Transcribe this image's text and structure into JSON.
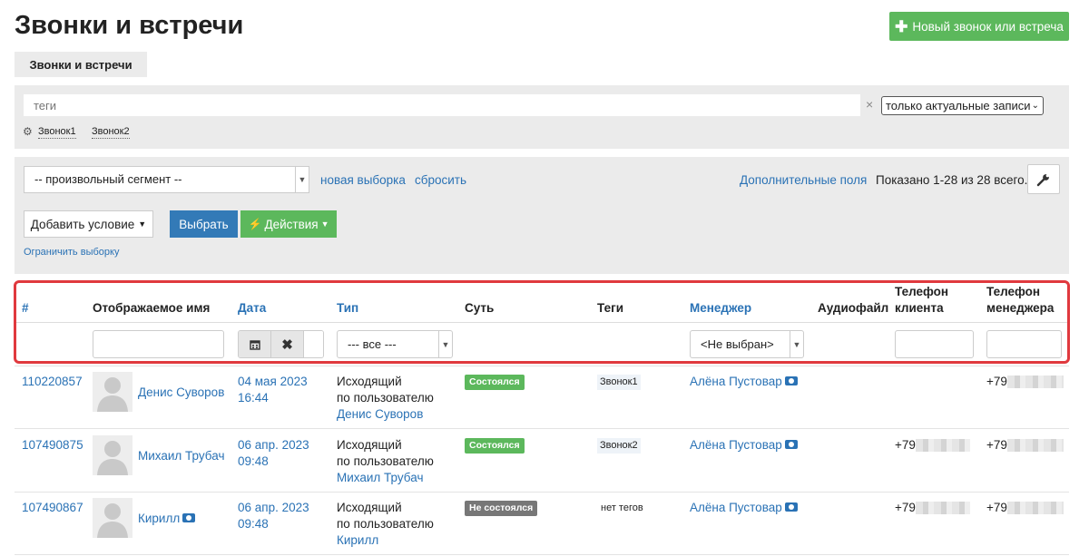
{
  "page": {
    "title": "Звонки и встречи",
    "new_button": "Новый звонок или встреча",
    "tab": "Звонки и встречи"
  },
  "filter": {
    "tags_placeholder": "теги",
    "clear": "×",
    "actual_select": "только актуальные записи",
    "tag_chips": [
      "Звонок1",
      "Звонок2"
    ]
  },
  "segment": {
    "select_value": "-- произвольный сегмент --",
    "new_selection": "новая выборка",
    "reset": "сбросить",
    "extra_fields": "Дополнительные поля",
    "shown": "Показано 1-28 из 28 всего.",
    "add_condition": "Добавить условие",
    "select_button": "Выбрать",
    "actions_button": "Действия",
    "limit_selection": "Ограничить выборку"
  },
  "table": {
    "headers": {
      "id": "#",
      "name": "Отображаемое имя",
      "date": "Дата",
      "type": "Тип",
      "essence": "Суть",
      "tags": "Теги",
      "manager": "Менеджер",
      "audio": "Аудиофайл",
      "client_phone_1": "Телефон",
      "client_phone_2": "клиента",
      "manager_phone_1": "Телефон",
      "manager_phone_2": "менеджера"
    },
    "filters": {
      "type_select": "--- все ---",
      "manager_select": "<Не выбран>"
    },
    "rows": [
      {
        "id": "110220857",
        "name": "Денис Суворов",
        "date": "04 мая 2023",
        "time": "16:44",
        "type_line1": "Исходящий",
        "type_line2": "по пользователю",
        "type_user": "Денис Суворов",
        "status": "Состоялся",
        "tag": "Звонок1",
        "manager": "Алёна Пустовар",
        "client_phone": "",
        "manager_phone": "+79"
      },
      {
        "id": "107490875",
        "name": "Михаил Трубач",
        "date": "06 апр. 2023",
        "time": "09:48",
        "type_line1": "Исходящий",
        "type_line2": "по пользователю",
        "type_user": "Михаил Трубач",
        "status": "Состоялся",
        "tag": "Звонок2",
        "manager": "Алёна Пустовар",
        "client_phone": "+79",
        "manager_phone": "+79"
      },
      {
        "id": "107490867",
        "name": "Кирилл",
        "date": "06 апр. 2023",
        "time": "09:48",
        "type_line1": "Исходящий",
        "type_line2": "по пользователю",
        "type_user": "Кирилл",
        "status": "Не состоялся",
        "tag": "нет тегов",
        "manager": "Алёна Пустовар",
        "client_phone": "+79",
        "manager_phone": "+79"
      }
    ]
  },
  "colors": {
    "link": "#2a72b5",
    "success": "#5cb85c",
    "primary": "#337ab7",
    "muted_badge": "#777777",
    "highlight": "#e0393e"
  }
}
